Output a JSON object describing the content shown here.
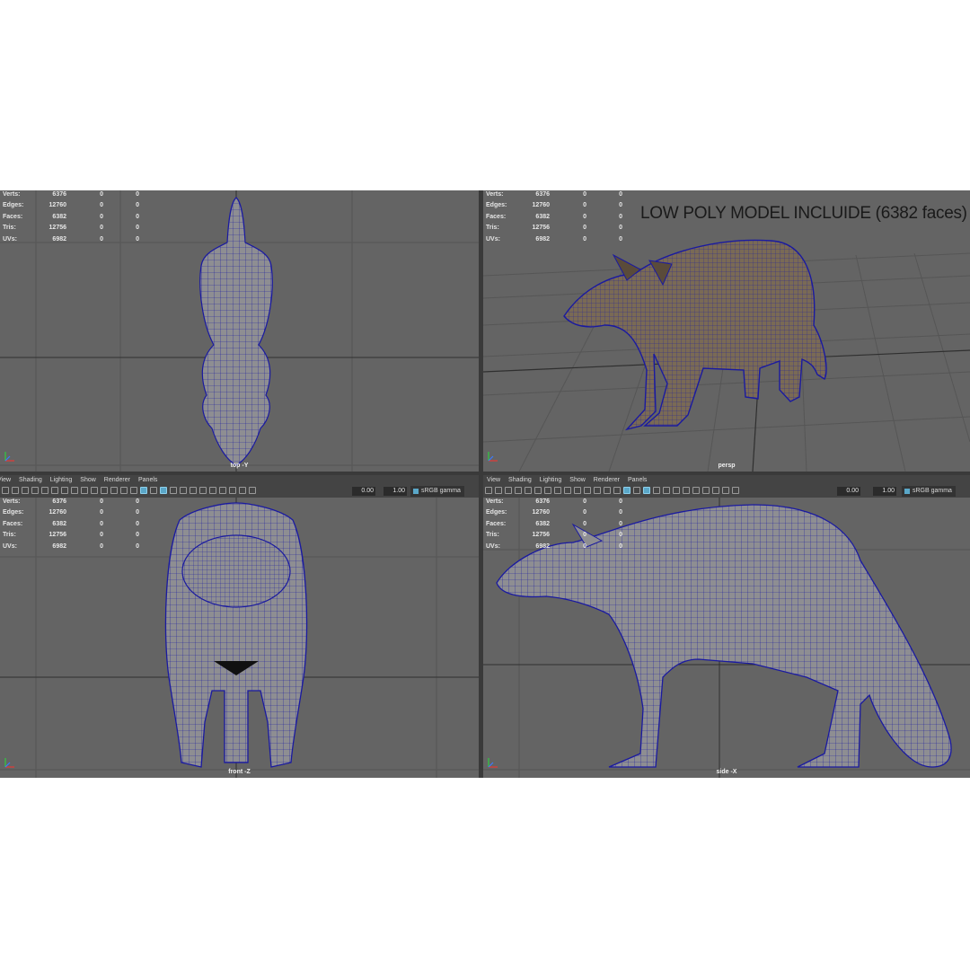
{
  "stats": {
    "rows": [
      {
        "label": "Verts:",
        "values": [
          "6376",
          "0",
          "0"
        ]
      },
      {
        "label": "Edges:",
        "values": [
          "12760",
          "0",
          "0"
        ]
      },
      {
        "label": "Faces:",
        "values": [
          "6382",
          "0",
          "0"
        ]
      },
      {
        "label": "Tris:",
        "values": [
          "12756",
          "0",
          "0"
        ]
      },
      {
        "label": "UVs:",
        "values": [
          "6982",
          "0",
          "0"
        ]
      }
    ]
  },
  "panel_menu": {
    "left": [
      "View",
      "Shading",
      "Lighting",
      "Show",
      "Renderer",
      "Panels"
    ],
    "right": [
      "View",
      "Shading",
      "Lighting",
      "Show",
      "Renderer",
      "Panels"
    ]
  },
  "toolbar": {
    "field_a": "0.00",
    "field_b": "1.00",
    "color_space": "sRGB gamma"
  },
  "viewports": {
    "top": "top -Y",
    "persp": "persp",
    "front": "front -Z",
    "side": "side -X"
  },
  "promo": "LOW POLY MODEL INCLUIDE (6382 faces)",
  "colors": {
    "viewport_bg": "#646464",
    "wire": "#1a1aa0",
    "panel_bg": "#444444",
    "accent": "#5aa7c8"
  },
  "icons": [
    "camera-icon",
    "grid-icon",
    "wireframe-icon",
    "smooth-shade-icon",
    "texture-icon",
    "light-icon",
    "isolate-icon",
    "xray-icon",
    "exposure-icon",
    "gamma-icon",
    "color-space-icon"
  ]
}
